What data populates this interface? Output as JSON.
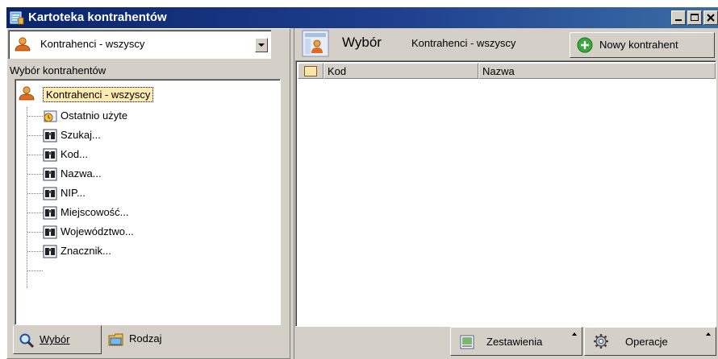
{
  "window": {
    "title": "Kartoteka kontrahentów",
    "buttons": {
      "minimize": "_",
      "maximize": "□",
      "close": "×"
    }
  },
  "left": {
    "combo": {
      "value": "Kontrahenci - wszyscy"
    },
    "label": "Wybór kontrahentów",
    "tree": {
      "root": "Kontrahenci - wszyscy",
      "items": [
        {
          "label": "Ostatnio użyte",
          "icon": "recent-icon"
        },
        {
          "label": "Szukaj...",
          "icon": "binoculars-icon"
        },
        {
          "label": "Kod...",
          "icon": "binoculars-icon"
        },
        {
          "label": "Nazwa...",
          "icon": "binoculars-icon"
        },
        {
          "label": "NIP...",
          "icon": "binoculars-icon"
        },
        {
          "label": "Miejscowość...",
          "icon": "binoculars-icon"
        },
        {
          "label": "Województwo...",
          "icon": "binoculars-icon"
        },
        {
          "label": "Znacznik...",
          "icon": "binoculars-icon"
        }
      ]
    },
    "tabs": [
      {
        "label": "Wybór",
        "icon": "magnifier-icon"
      },
      {
        "label": "Rodzaj",
        "icon": "folder-icon"
      }
    ]
  },
  "right": {
    "header": {
      "title": "Wybór",
      "subtitle": "Kontrahenci - wszyscy"
    },
    "new_button": "Nowy kontrahent",
    "columns": [
      "Kod",
      "Nazwa"
    ],
    "footer": {
      "reports": "Zestawienia",
      "operations": "Operacje"
    }
  },
  "colors": {
    "titlebar": "#0a246a",
    "face": "#d4d0c8",
    "selection_outline": "#000000"
  }
}
